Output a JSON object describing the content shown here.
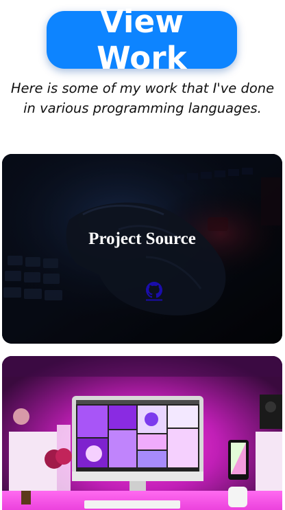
{
  "hero": {
    "button_label": "View Work",
    "intro_text": "Here is some of my work that I've done in various programming languages."
  },
  "projects": [
    {
      "title": "Project Source",
      "link_icon": "github-icon",
      "image_subject": "keyboard-typing-photo"
    },
    {
      "image_subject": "desk-setup-monitor-photo"
    }
  ],
  "colors": {
    "accent": "#0d84ff",
    "link": "#1a0dab",
    "card_title": "#ffffff"
  }
}
